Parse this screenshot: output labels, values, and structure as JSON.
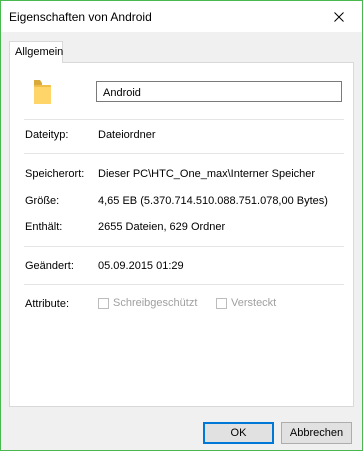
{
  "window": {
    "title": "Eigenschaften von Android",
    "accent_color": "#49b84f"
  },
  "tabs": [
    {
      "label": "Allgemein",
      "active": true
    }
  ],
  "general": {
    "icon": "folder-icon",
    "name_value": "Android",
    "type_label": "Dateityp:",
    "type_value": "Dateiordner",
    "location_label": "Speicherort:",
    "location_value": "Dieser PC\\HTC_One_max\\Interner Speicher",
    "size_label": "Größe:",
    "size_value": "4,65 EB (5.370.714.510.088.751.078,00 Bytes)",
    "contains_label": "Enthält:",
    "contains_value": "2655 Dateien, 629 Ordner",
    "modified_label": "Geändert:",
    "modified_value": "05.09.2015 01:29",
    "attributes_label": "Attribute:",
    "readonly_label": "Schreibgeschützt",
    "readonly_checked": false,
    "hidden_label": "Versteckt",
    "hidden_checked": false
  },
  "buttons": {
    "ok_label": "OK",
    "cancel_label": "Abbrechen"
  }
}
